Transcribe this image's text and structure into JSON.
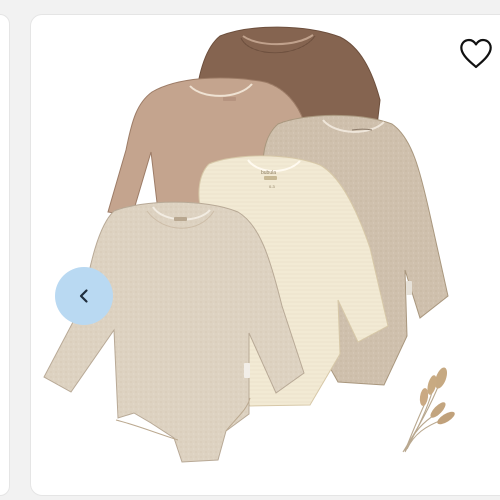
{
  "gallery": {
    "product_image": {
      "label_brand": "bubula",
      "label_size": "0-3"
    },
    "favorite_button": {
      "icon": "heart-outline-icon",
      "color": "#111111"
    },
    "prev_button": {
      "icon": "chevron-left-icon",
      "background": "#b9d9f2",
      "color": "#1f2d3d"
    }
  }
}
